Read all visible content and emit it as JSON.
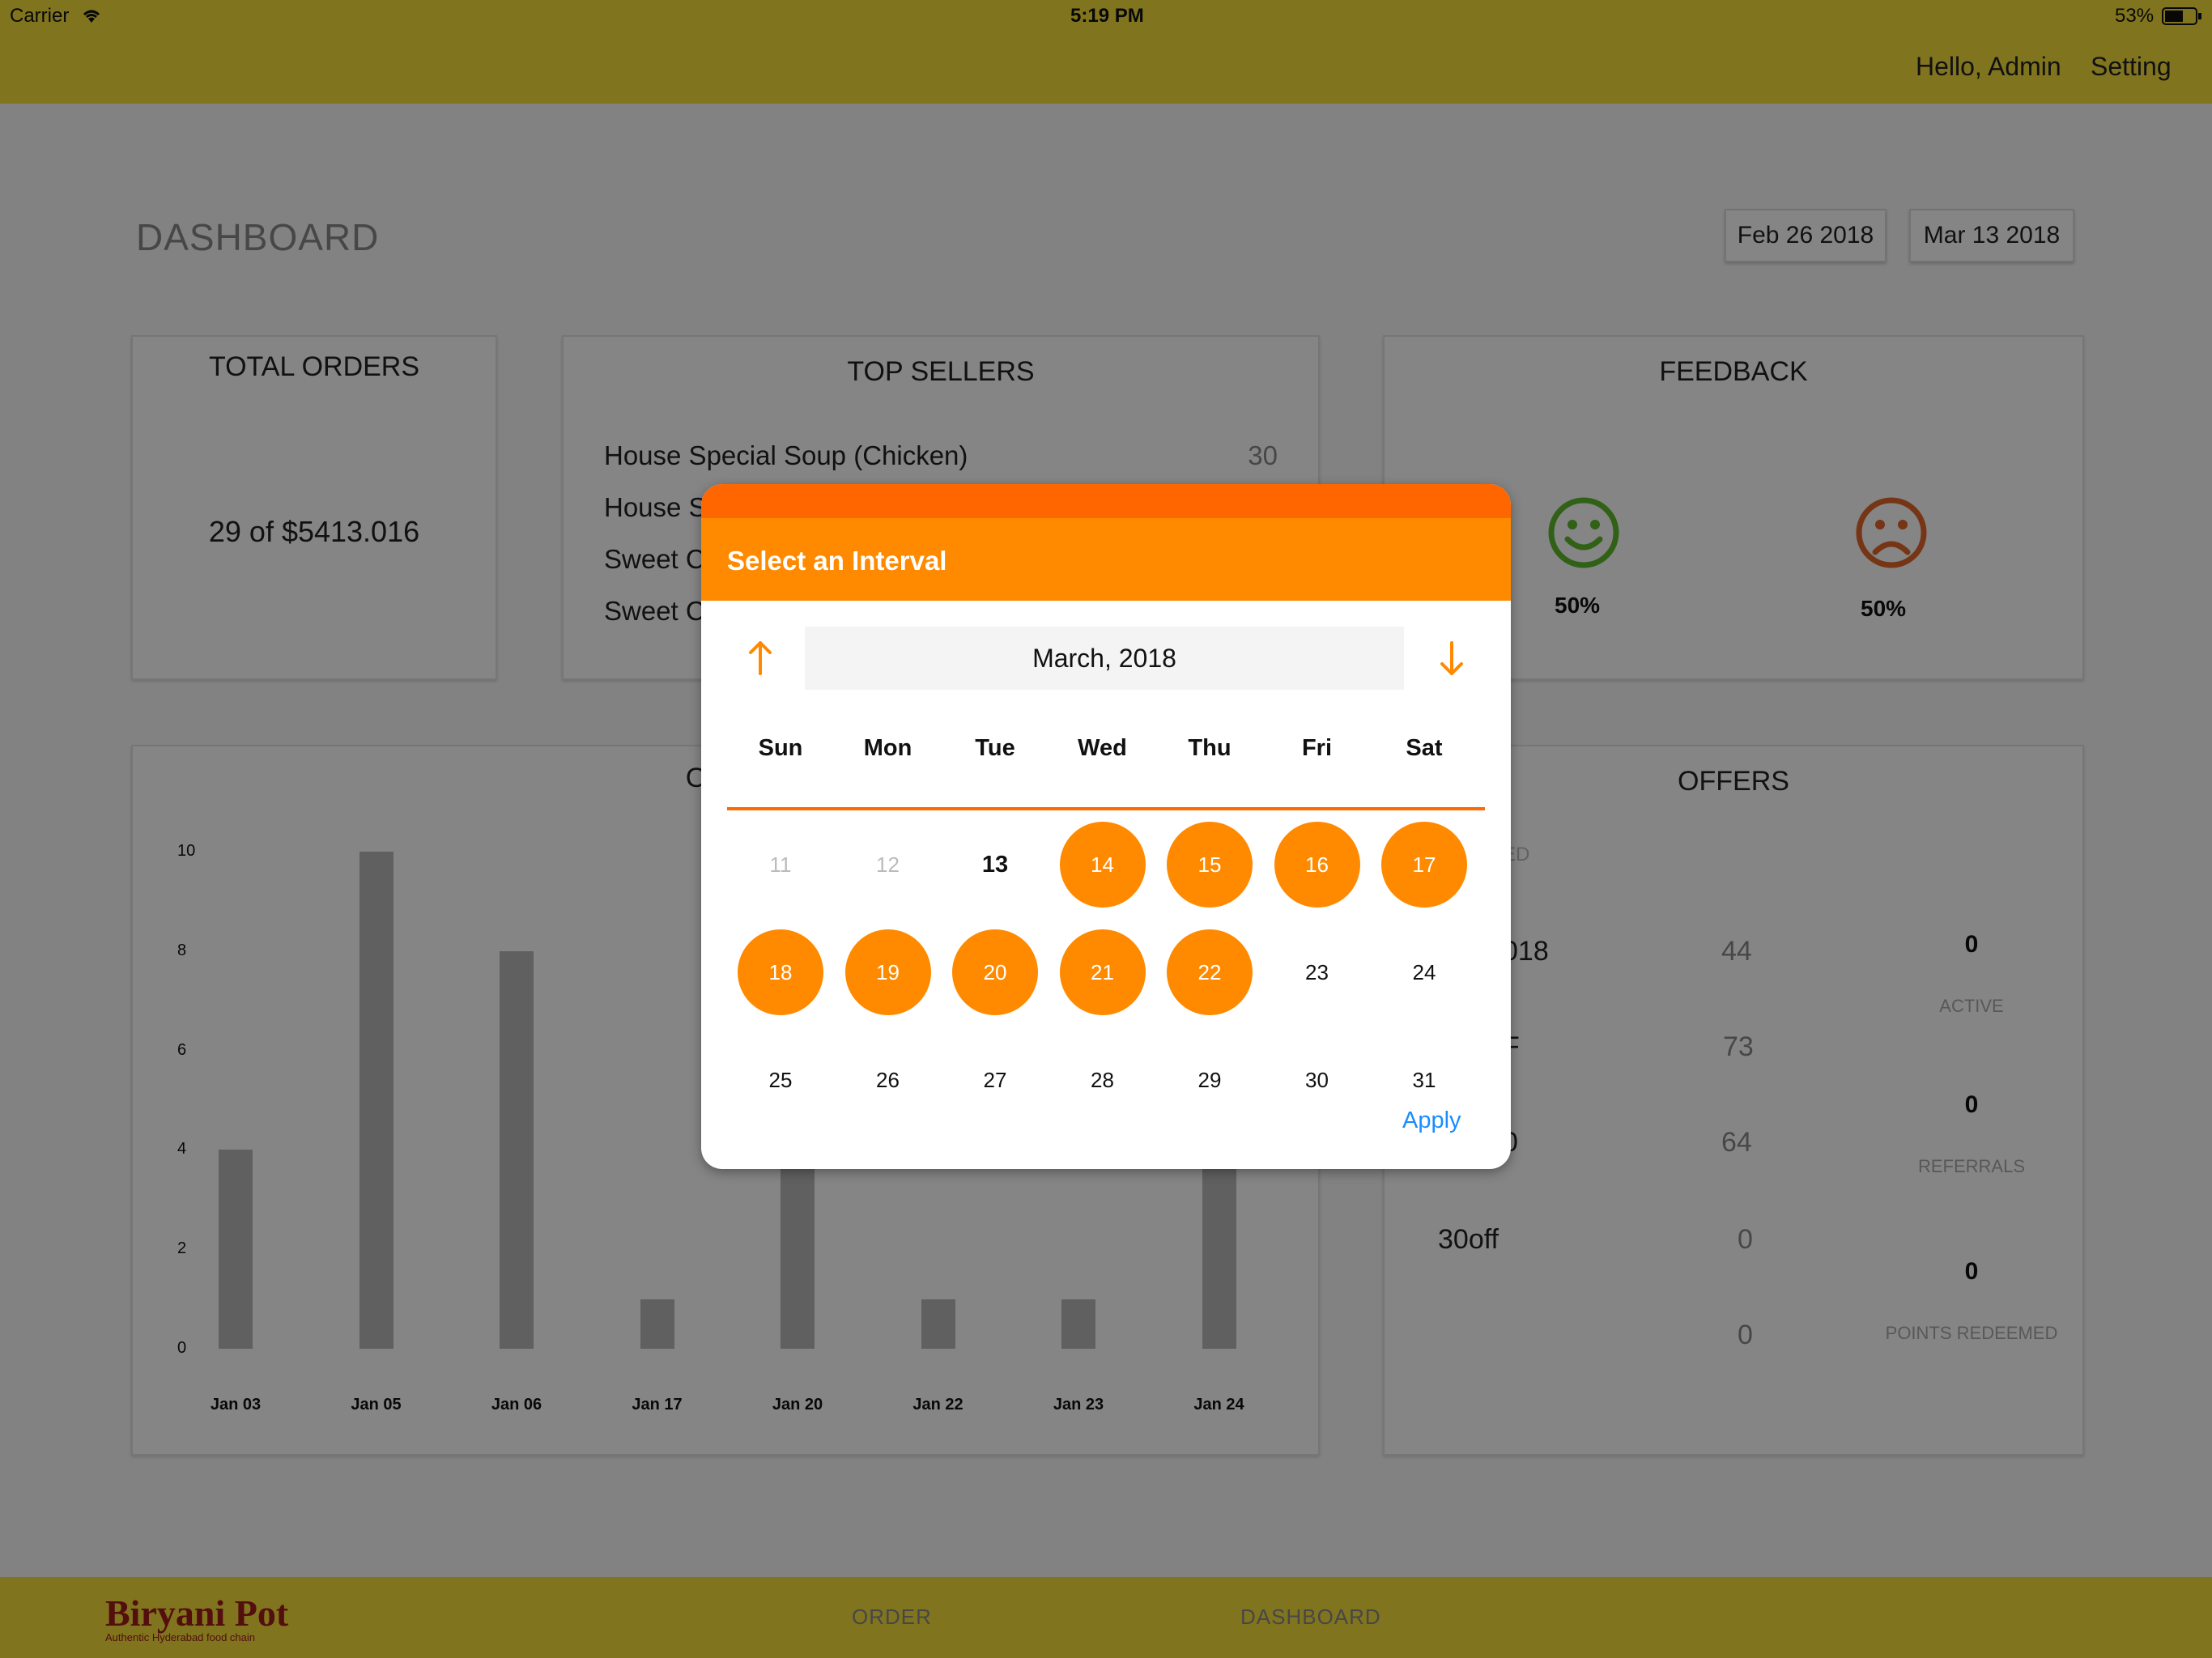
{
  "status_bar": {
    "carrier": "Carrier",
    "time": "5:19 PM",
    "battery": "53%"
  },
  "header": {
    "greeting": "Hello, Admin",
    "setting": "Setting"
  },
  "dashboard": {
    "title": "DASHBOARD",
    "date_from": "Feb 26 2018",
    "date_to": "Mar 13 2018",
    "total_orders": {
      "title": "TOTAL ORDERS",
      "value": "29 of $5413.016"
    },
    "top_sellers": {
      "title": "TOP SELLERS",
      "items": [
        {
          "name": "House Special Soup (Chicken)",
          "count": "30"
        },
        {
          "name": "House S",
          "count": ""
        },
        {
          "name": "Sweet C",
          "count": ""
        },
        {
          "name": "Sweet C",
          "count": ""
        }
      ]
    },
    "feedback": {
      "title": "FEEDBACK",
      "positive": "50%",
      "negative": "50%"
    },
    "orders_chart_title": "ORDE",
    "offers": {
      "title": "OFFERS",
      "partial_header": "ED",
      "rows": [
        {
          "name": "018",
          "value": "44"
        },
        {
          "name": "F",
          "value": "73"
        },
        {
          "name": "0",
          "value": "64"
        },
        {
          "name": "30off",
          "value": "0"
        },
        {
          "name": "",
          "value": "0"
        }
      ],
      "stats": [
        {
          "value": "0",
          "label": "ACTIVE"
        },
        {
          "value": "0",
          "label": "REFERRALS"
        },
        {
          "value": "0",
          "label": "POINTS REDEEMED"
        }
      ]
    }
  },
  "chart_data": {
    "type": "bar",
    "title": "",
    "categories": [
      "Jan 03",
      "Jan 05",
      "Jan 06",
      "Jan 17",
      "Jan 20",
      "Jan 22",
      "Jan 23",
      "Jan 24"
    ],
    "values": [
      4,
      10,
      8,
      1,
      4,
      1,
      1,
      4
    ],
    "ylim": [
      0,
      10
    ],
    "yticks": [
      "0",
      "2",
      "4",
      "6",
      "8",
      "10"
    ],
    "grid": false
  },
  "bottom_bar": {
    "logo_text": "Biryani Pot",
    "logo_tagline": "Authentic Hyderabad food chain",
    "tabs": [
      "ORDER",
      "DASHBOARD"
    ]
  },
  "date_picker": {
    "title": "Select an Interval",
    "month": "March, 2018",
    "weekdays": [
      "Sun",
      "Mon",
      "Tue",
      "Wed",
      "Thu",
      "Fri",
      "Sat"
    ],
    "weeks": [
      [
        "11",
        "12",
        "13",
        "14",
        "15",
        "16",
        "17"
      ],
      [
        "18",
        "19",
        "20",
        "21",
        "22",
        "23",
        "24"
      ],
      [
        "25",
        "26",
        "27",
        "28",
        "29",
        "30",
        "31"
      ]
    ],
    "selected": [
      "14",
      "15",
      "16",
      "17",
      "18",
      "19",
      "20",
      "21",
      "22"
    ],
    "disabled": [
      "11",
      "12"
    ],
    "today": "13",
    "apply": "Apply",
    "accent": "#ff8a00"
  }
}
